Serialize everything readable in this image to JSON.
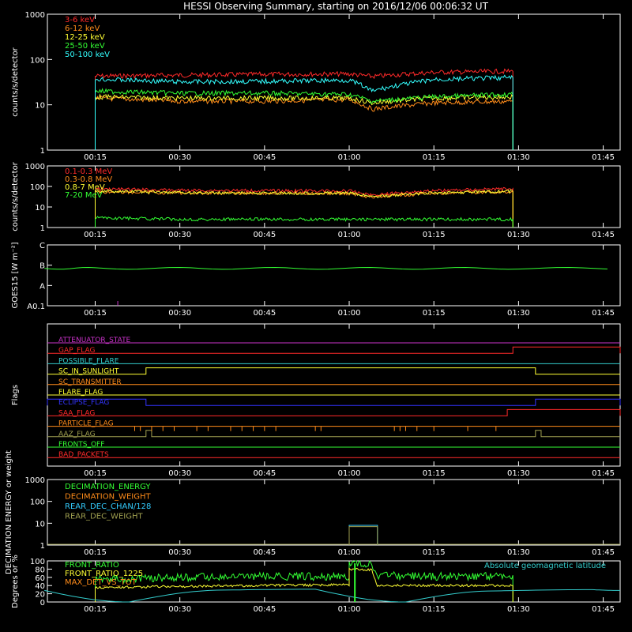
{
  "title": "HESSI Observing Summary, starting on 2016/12/06 00:06:32 UT",
  "time_ticks": [
    "00:15",
    "00:30",
    "00:45",
    "01:00",
    "01:15",
    "01:30",
    "01:45"
  ],
  "chart_data": [
    {
      "id": "count-rates-low",
      "type": "line",
      "ylabel": "counts/s/detector",
      "yscale": "log",
      "ylim": [
        1,
        1000
      ],
      "yticks": [
        "1",
        "10",
        "100",
        "1000"
      ],
      "observation_window": [
        "00:15",
        "01:29"
      ],
      "series": [
        {
          "name": "3-6 keV",
          "color": "#ff2a2a",
          "x": [
            "00:15",
            "00:30",
            "00:45",
            "01:00",
            "01:04",
            "01:15",
            "01:29"
          ],
          "y": [
            43,
            45,
            47,
            48,
            42,
            52,
            55
          ]
        },
        {
          "name": "6-12 keV",
          "color": "#ff8c1a",
          "x": [
            "00:15",
            "00:30",
            "00:45",
            "01:00",
            "01:04",
            "01:15",
            "01:29"
          ],
          "y": [
            14,
            12,
            12,
            13,
            8,
            11,
            12
          ]
        },
        {
          "name": "12-25 keV",
          "color": "#ffff33",
          "x": [
            "00:15",
            "00:30",
            "00:45",
            "01:00",
            "01:04",
            "01:15",
            "01:29"
          ],
          "y": [
            15,
            14,
            14,
            14,
            11,
            14,
            15
          ]
        },
        {
          "name": "25-50 keV",
          "color": "#33ff33",
          "x": [
            "00:15",
            "00:30",
            "00:45",
            "01:00",
            "01:04",
            "01:15",
            "01:29"
          ],
          "y": [
            20,
            18,
            18,
            17,
            12,
            15,
            17
          ]
        },
        {
          "name": "50-100 keV",
          "color": "#33ffff",
          "x": [
            "00:15",
            "00:30",
            "00:45",
            "01:00",
            "01:04",
            "01:15",
            "01:29"
          ],
          "y": [
            37,
            32,
            33,
            35,
            20,
            36,
            40
          ]
        }
      ]
    },
    {
      "id": "count-rates-high",
      "type": "line",
      "ylabel": "counts/s/detector",
      "yscale": "log",
      "ylim": [
        1,
        1000
      ],
      "yticks": [
        "1",
        "10",
        "100",
        "1000"
      ],
      "observation_window": [
        "00:15",
        "01:29"
      ],
      "series": [
        {
          "name": "0.1-0.3 MeV",
          "color": "#ff2a2a",
          "x": [
            "00:15",
            "00:30",
            "00:45",
            "01:00",
            "01:04",
            "01:15",
            "01:29"
          ],
          "y": [
            75,
            65,
            62,
            60,
            38,
            62,
            78
          ]
        },
        {
          "name": "0.3-0.8 MeV",
          "color": "#ff8c1a",
          "x": [
            "00:15",
            "00:30",
            "00:45",
            "01:00",
            "01:04",
            "01:15",
            "01:29"
          ],
          "y": [
            55,
            48,
            46,
            45,
            30,
            46,
            55
          ]
        },
        {
          "name": "0.8-7 MeV",
          "color": "#ffff33",
          "x": [
            "00:15",
            "00:30",
            "00:45",
            "01:00",
            "01:04",
            "01:15",
            "01:29"
          ],
          "y": [
            60,
            50,
            48,
            47,
            32,
            48,
            58
          ]
        },
        {
          "name": "7-20 MeV",
          "color": "#33ff33",
          "x": [
            "00:15",
            "00:30",
            "00:45",
            "01:00",
            "01:04",
            "01:15",
            "01:29"
          ],
          "y": [
            3,
            2.5,
            2.5,
            2.5,
            2.5,
            2.5,
            2.5
          ]
        }
      ]
    },
    {
      "id": "goes-flux",
      "type": "line",
      "ylabel": "GOES15 [W m⁻²]",
      "yticks": [
        "A0.1",
        "A",
        "B",
        "C"
      ],
      "series": [
        {
          "name": "GOES15",
          "color": "#33ff33",
          "x": [
            "00:06",
            "00:15",
            "00:30",
            "00:45",
            "01:00",
            "01:15",
            "01:30",
            "01:48"
          ],
          "y": [
            "B",
            "B",
            "B",
            "B",
            "B",
            "B",
            "B",
            "B"
          ]
        }
      ]
    },
    {
      "id": "flags",
      "type": "table",
      "ylabel": "Flags",
      "flags": [
        {
          "name": "ATTENUATOR_STATE",
          "color": "#cc33cc"
        },
        {
          "name": "GAP_FLAG",
          "color": "#ff2a2a"
        },
        {
          "name": "POSSIBLE_FLARE",
          "color": "#33cccc"
        },
        {
          "name": "SC_IN_SUNLIGHT",
          "color": "#ffff33"
        },
        {
          "name": "SC_TRANSMITTER",
          "color": "#ff8c1a"
        },
        {
          "name": "FLARE_FLAG",
          "color": "#ffff33"
        },
        {
          "name": "ECLIPSE_FLAG",
          "color": "#3333ff"
        },
        {
          "name": "SAA_FLAG",
          "color": "#ff2a2a"
        },
        {
          "name": "PARTICLE_FLAG",
          "color": "#ff8c1a"
        },
        {
          "name": "AAZ_FLAG",
          "color": "#a0a050"
        },
        {
          "name": "FRONTS_OFF",
          "color": "#33ff33"
        },
        {
          "name": "BAD_PACKETS",
          "color": "#ff2a2a"
        }
      ],
      "segments": {
        "GAP_FLAG": [
          [
            "01:29",
            "01:48"
          ]
        ],
        "SC_IN_SUNLIGHT": [
          [
            "00:24",
            "01:33"
          ]
        ],
        "ECLIPSE_FLAG": [
          [
            "00:06",
            "00:24"
          ],
          [
            "01:33",
            "01:48"
          ]
        ],
        "SAA_FLAG": [
          [
            "01:28",
            "01:48"
          ]
        ],
        "AAZ_FLAG": [
          [
            "00:24",
            "00:25"
          ],
          [
            "01:33",
            "01:34"
          ]
        ]
      }
    },
    {
      "id": "decimation",
      "type": "line",
      "ylabel": "DECIMATION ENERGY or weight",
      "yscale": "log",
      "ylim": [
        1,
        1000
      ],
      "yticks": [
        "1",
        "10",
        "100",
        "1000"
      ],
      "series": [
        {
          "name": "DECIMATION_ENERGY",
          "color": "#33ff33"
        },
        {
          "name": "DECIMATION_WEIGHT",
          "color": "#ff8c1a"
        },
        {
          "name": "REAR_DEC_CHAN/128",
          "color": "#33ccff",
          "x": [
            "01:00",
            "01:00",
            "01:05",
            "01:05"
          ],
          "y": [
            1,
            8,
            8,
            1
          ]
        },
        {
          "name": "REAR_DEC_WEIGHT",
          "color": "#a0a050",
          "x": [
            "01:00",
            "01:00",
            "01:05",
            "01:05"
          ],
          "y": [
            1,
            7,
            7,
            1
          ]
        }
      ]
    },
    {
      "id": "ratios",
      "type": "line",
      "ylabel": "Degrees or %",
      "ylim": [
        0,
        100
      ],
      "yticks": [
        "0",
        "20",
        "40",
        "60",
        "80",
        "100"
      ],
      "series": [
        {
          "name": "FRONT_RATIO",
          "color": "#33ff33",
          "x": [
            "00:15",
            "00:30",
            "00:45",
            "01:00",
            "01:00",
            "01:04",
            "01:05",
            "01:15",
            "01:29"
          ],
          "y": [
            55,
            60,
            62,
            62,
            95,
            93,
            65,
            62,
            65
          ]
        },
        {
          "name": "FRONT_RATIO_1225",
          "color": "#ffff33",
          "x": [
            "00:15",
            "00:30",
            "00:45",
            "01:00",
            "01:00",
            "01:04",
            "01:05",
            "01:15",
            "01:29"
          ],
          "y": [
            35,
            38,
            40,
            42,
            80,
            78,
            40,
            40,
            40
          ]
        },
        {
          "name": "MAX_DET_VS_TOT",
          "color": "#ff8c1a"
        },
        {
          "name": "Absolute geomagnetic latitude",
          "color": "#33cccc",
          "x": [
            "00:06",
            "00:21",
            "00:38",
            "00:54",
            "01:10",
            "01:26",
            "01:43",
            "01:48"
          ],
          "y": [
            28,
            0,
            29,
            31,
            0,
            27,
            30,
            28
          ]
        }
      ]
    }
  ]
}
